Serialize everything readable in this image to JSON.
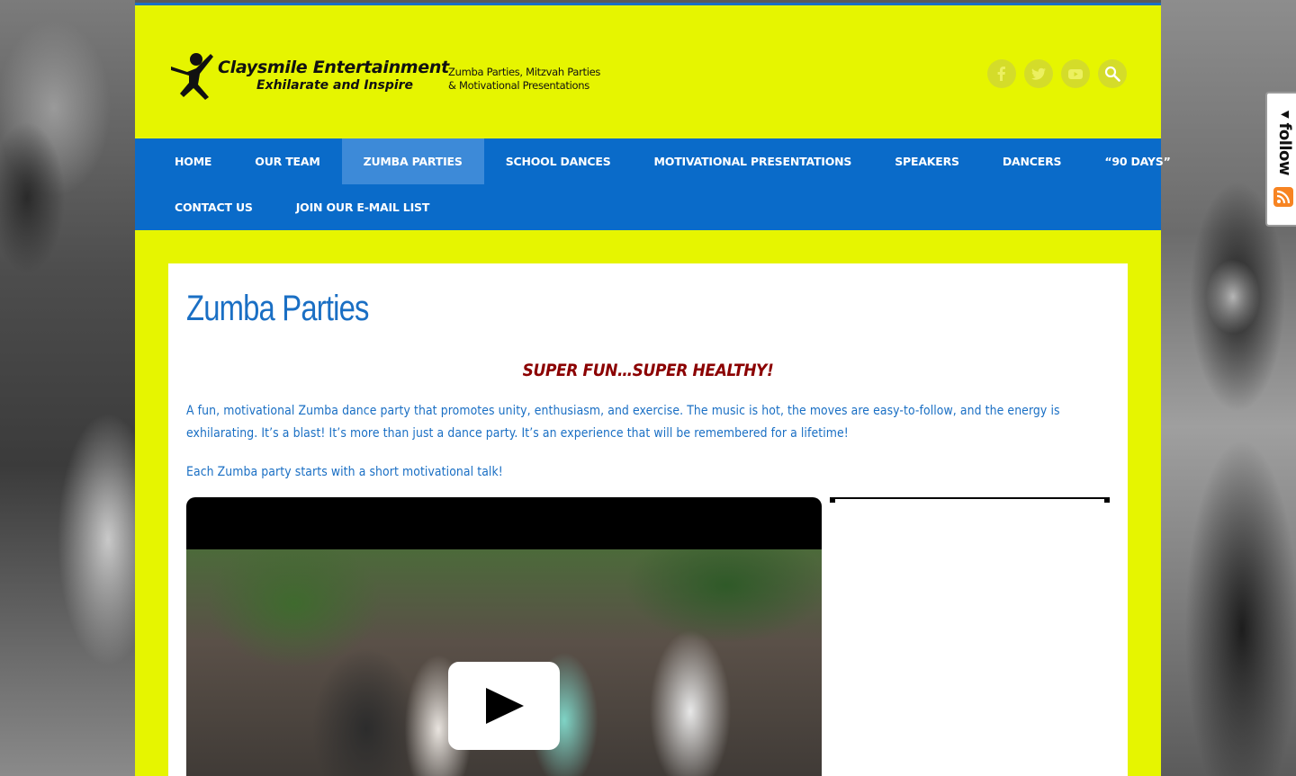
{
  "brand": {
    "name": "Claysmile Entertainment",
    "slogan": "Exhilarate and Inspire",
    "tagline_line1": "Zumba Parties, Mitzvah Parties",
    "tagline_line2": "& Motivational Presentations"
  },
  "social": [
    {
      "icon": "facebook-icon"
    },
    {
      "icon": "twitter-icon"
    },
    {
      "icon": "youtube-icon"
    },
    {
      "icon": "search-icon"
    }
  ],
  "nav": {
    "row1": [
      "HOME",
      "OUR TEAM",
      "ZUMBA PARTIES",
      "SCHOOL DANCES",
      "MOTIVATIONAL PRESENTATIONS",
      "SPEAKERS",
      "DANCERS",
      "“90 DAYS”"
    ],
    "row2": [
      "CONTACT US",
      "JOIN OUR E-MAIL LIST"
    ],
    "active": "ZUMBA PARTIES"
  },
  "main": {
    "title": "Zumba Parties",
    "headline": "SUPER FUN…SUPER HEALTHY!",
    "paragraph": "A fun, motivational Zumba dance party that promotes unity, enthusiasm, and exercise.  The music is hot, the moves are easy-to-follow, and the energy is exhilarating.  It’s a blast!  It’s more than just a dance party.  It’s an experience that will be remembered for a lifetime!",
    "paragraph2": "Each Zumba party starts with a short motivational talk!"
  },
  "widget": {
    "follow_label": "◂follow",
    "rss_icon": "rss-icon"
  },
  "colors": {
    "page_bg": "#e6f500",
    "nav_bg": "#0a6bc9",
    "nav_active": "#3d8ad8",
    "title": "#1a6fc4",
    "headline": "#8b0000"
  }
}
